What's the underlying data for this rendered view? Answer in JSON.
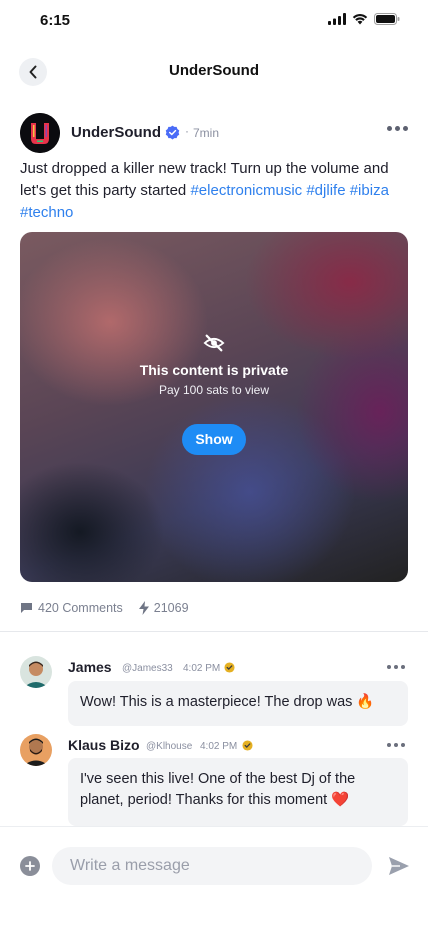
{
  "status_bar": {
    "time": "6:15"
  },
  "header": {
    "title": "UnderSound"
  },
  "post": {
    "author": "UnderSound",
    "time": "7min",
    "text": "Just dropped a killer new track! Turn up the volume and let's get this party started ",
    "hashtags": [
      "#electronicmusic",
      "#djlife",
      "#ibiza",
      "#techno"
    ],
    "media": {
      "private_title": "This content is private",
      "private_subtitle": "Pay 100 sats to view",
      "show_label": "Show"
    },
    "stats": {
      "comments": "420 Comments",
      "zaps": "21069"
    }
  },
  "comments": [
    {
      "name": "James",
      "handle": "@James33",
      "time": "4:02 PM",
      "text": "Wow! This is a masterpiece! The drop was 🔥"
    },
    {
      "name": "Klaus Bizo",
      "handle": "@Klhouse",
      "time": "4:02 PM",
      "text": "I've seen this live! One of the best Dj of the planet, period! Thanks for this moment ❤️"
    }
  ],
  "composer": {
    "placeholder": "Write a message"
  },
  "colors": {
    "accent": "#1e8cf5",
    "hashtag": "#2f80ed"
  }
}
